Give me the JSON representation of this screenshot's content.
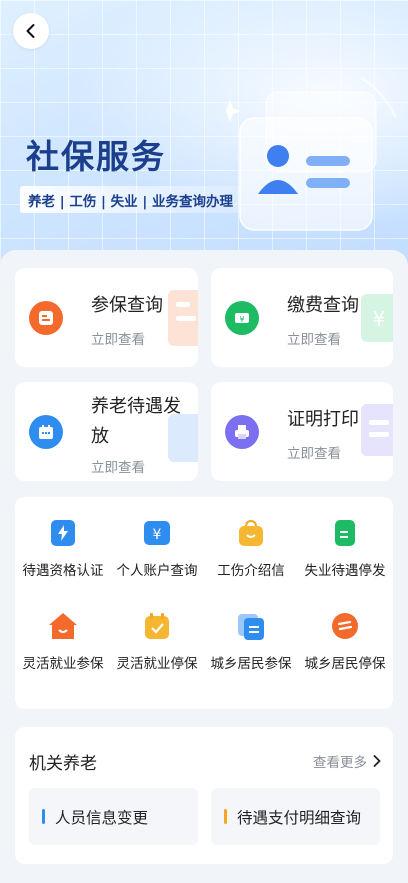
{
  "header": {
    "title": "社保服务",
    "tags": "养老 | 工伤 | 失业 | 业务查询办理"
  },
  "tiles": [
    {
      "title": "参保查询",
      "sub": "立即查看",
      "icon": "id-card-icon",
      "color": "#f36a2c"
    },
    {
      "title": "缴费查询",
      "sub": "立即查看",
      "icon": "ticket-icon",
      "color": "#1dbb63"
    },
    {
      "title_line1": "养老待遇发",
      "title_line2": "放",
      "sub": "立即查看",
      "icon": "calendar-icon",
      "color": "#2f8df0"
    },
    {
      "title": "证明打印",
      "sub": "立即查看",
      "icon": "printer-icon",
      "color": "#7b6ff2"
    }
  ],
  "grid": [
    {
      "label": "待遇资格认证",
      "icon": "lightning-icon"
    },
    {
      "label": "个人账户查询",
      "icon": "yuan-card-icon"
    },
    {
      "label": "工伤介绍信",
      "icon": "bag-icon"
    },
    {
      "label": "失业待遇停发",
      "icon": "phone-doc-icon"
    },
    {
      "label": "灵活就业参保",
      "icon": "house-icon"
    },
    {
      "label": "灵活就业停保",
      "icon": "calendar-check-icon"
    },
    {
      "label": "城乡居民参保",
      "icon": "cards-icon"
    },
    {
      "label": "城乡居民停保",
      "icon": "circle-badge-icon"
    }
  ],
  "org": {
    "title": "机关养老",
    "more": "查看更多",
    "items": [
      {
        "label": "人员信息变更",
        "bar_color": "#2f8df0"
      },
      {
        "label": "待遇支付明细查询",
        "bar_color": "#f5a623"
      }
    ]
  }
}
